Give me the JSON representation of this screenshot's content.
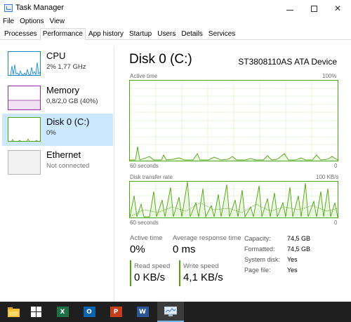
{
  "window": {
    "title": "Task Manager"
  },
  "menu": [
    "File",
    "Options",
    "View"
  ],
  "tabs": [
    "Processes",
    "Performance",
    "App history",
    "Startup",
    "Users",
    "Details",
    "Services"
  ],
  "active_tab": "Performance",
  "sidebar": {
    "items": [
      {
        "name": "CPU",
        "sub": "2%  1,77 GHz",
        "color": "#1787c8"
      },
      {
        "name": "Memory",
        "sub": "0,8/2,0 GB (40%)",
        "color": "#9a2aa8"
      },
      {
        "name": "Disk 0 (C:)",
        "sub": "0%",
        "color": "#4da60c"
      },
      {
        "name": "Ethernet",
        "sub": "Not connected",
        "color": "#a0a0a0"
      }
    ],
    "selected": "Disk 0 (C:)"
  },
  "main": {
    "title": "Disk 0 (C:)",
    "device": "ST3808110AS ATA Device",
    "active_time_graph": {
      "label": "Active time",
      "max_label": "100%",
      "x_label": "60 seconds",
      "min_label": "0"
    },
    "transfer_graph": {
      "label": "Disk transfer rate",
      "max_label": "100 KB/s",
      "x_label": "60 seconds",
      "min_label": "0"
    },
    "stats": {
      "active_time_label": "Active time",
      "active_time_value": "0%",
      "response_label": "Average response time",
      "response_value": "0 ms",
      "read_label": "Read speed",
      "read_value": "0 KB/s",
      "write_label": "Write speed",
      "write_value": "4,1 KB/s"
    },
    "properties": [
      {
        "label": "Capacity:",
        "value": "74,5 GB"
      },
      {
        "label": "Formatted:",
        "value": "74,5 GB"
      },
      {
        "label": "System disk:",
        "value": "Yes"
      },
      {
        "label": "Page file:",
        "value": "Yes"
      }
    ]
  },
  "taskbar": {
    "items": [
      "file-explorer-icon",
      "windows-store-icon",
      "excel-icon",
      "outlook-icon",
      "powerpoint-icon",
      "word-icon",
      "task-manager-icon"
    ],
    "colors": {
      "excel": "#1d7044",
      "outlook": "#0a64ad",
      "powerpoint": "#c43e1c",
      "word": "#2b579a",
      "explorer": "#f3c13a"
    }
  }
}
